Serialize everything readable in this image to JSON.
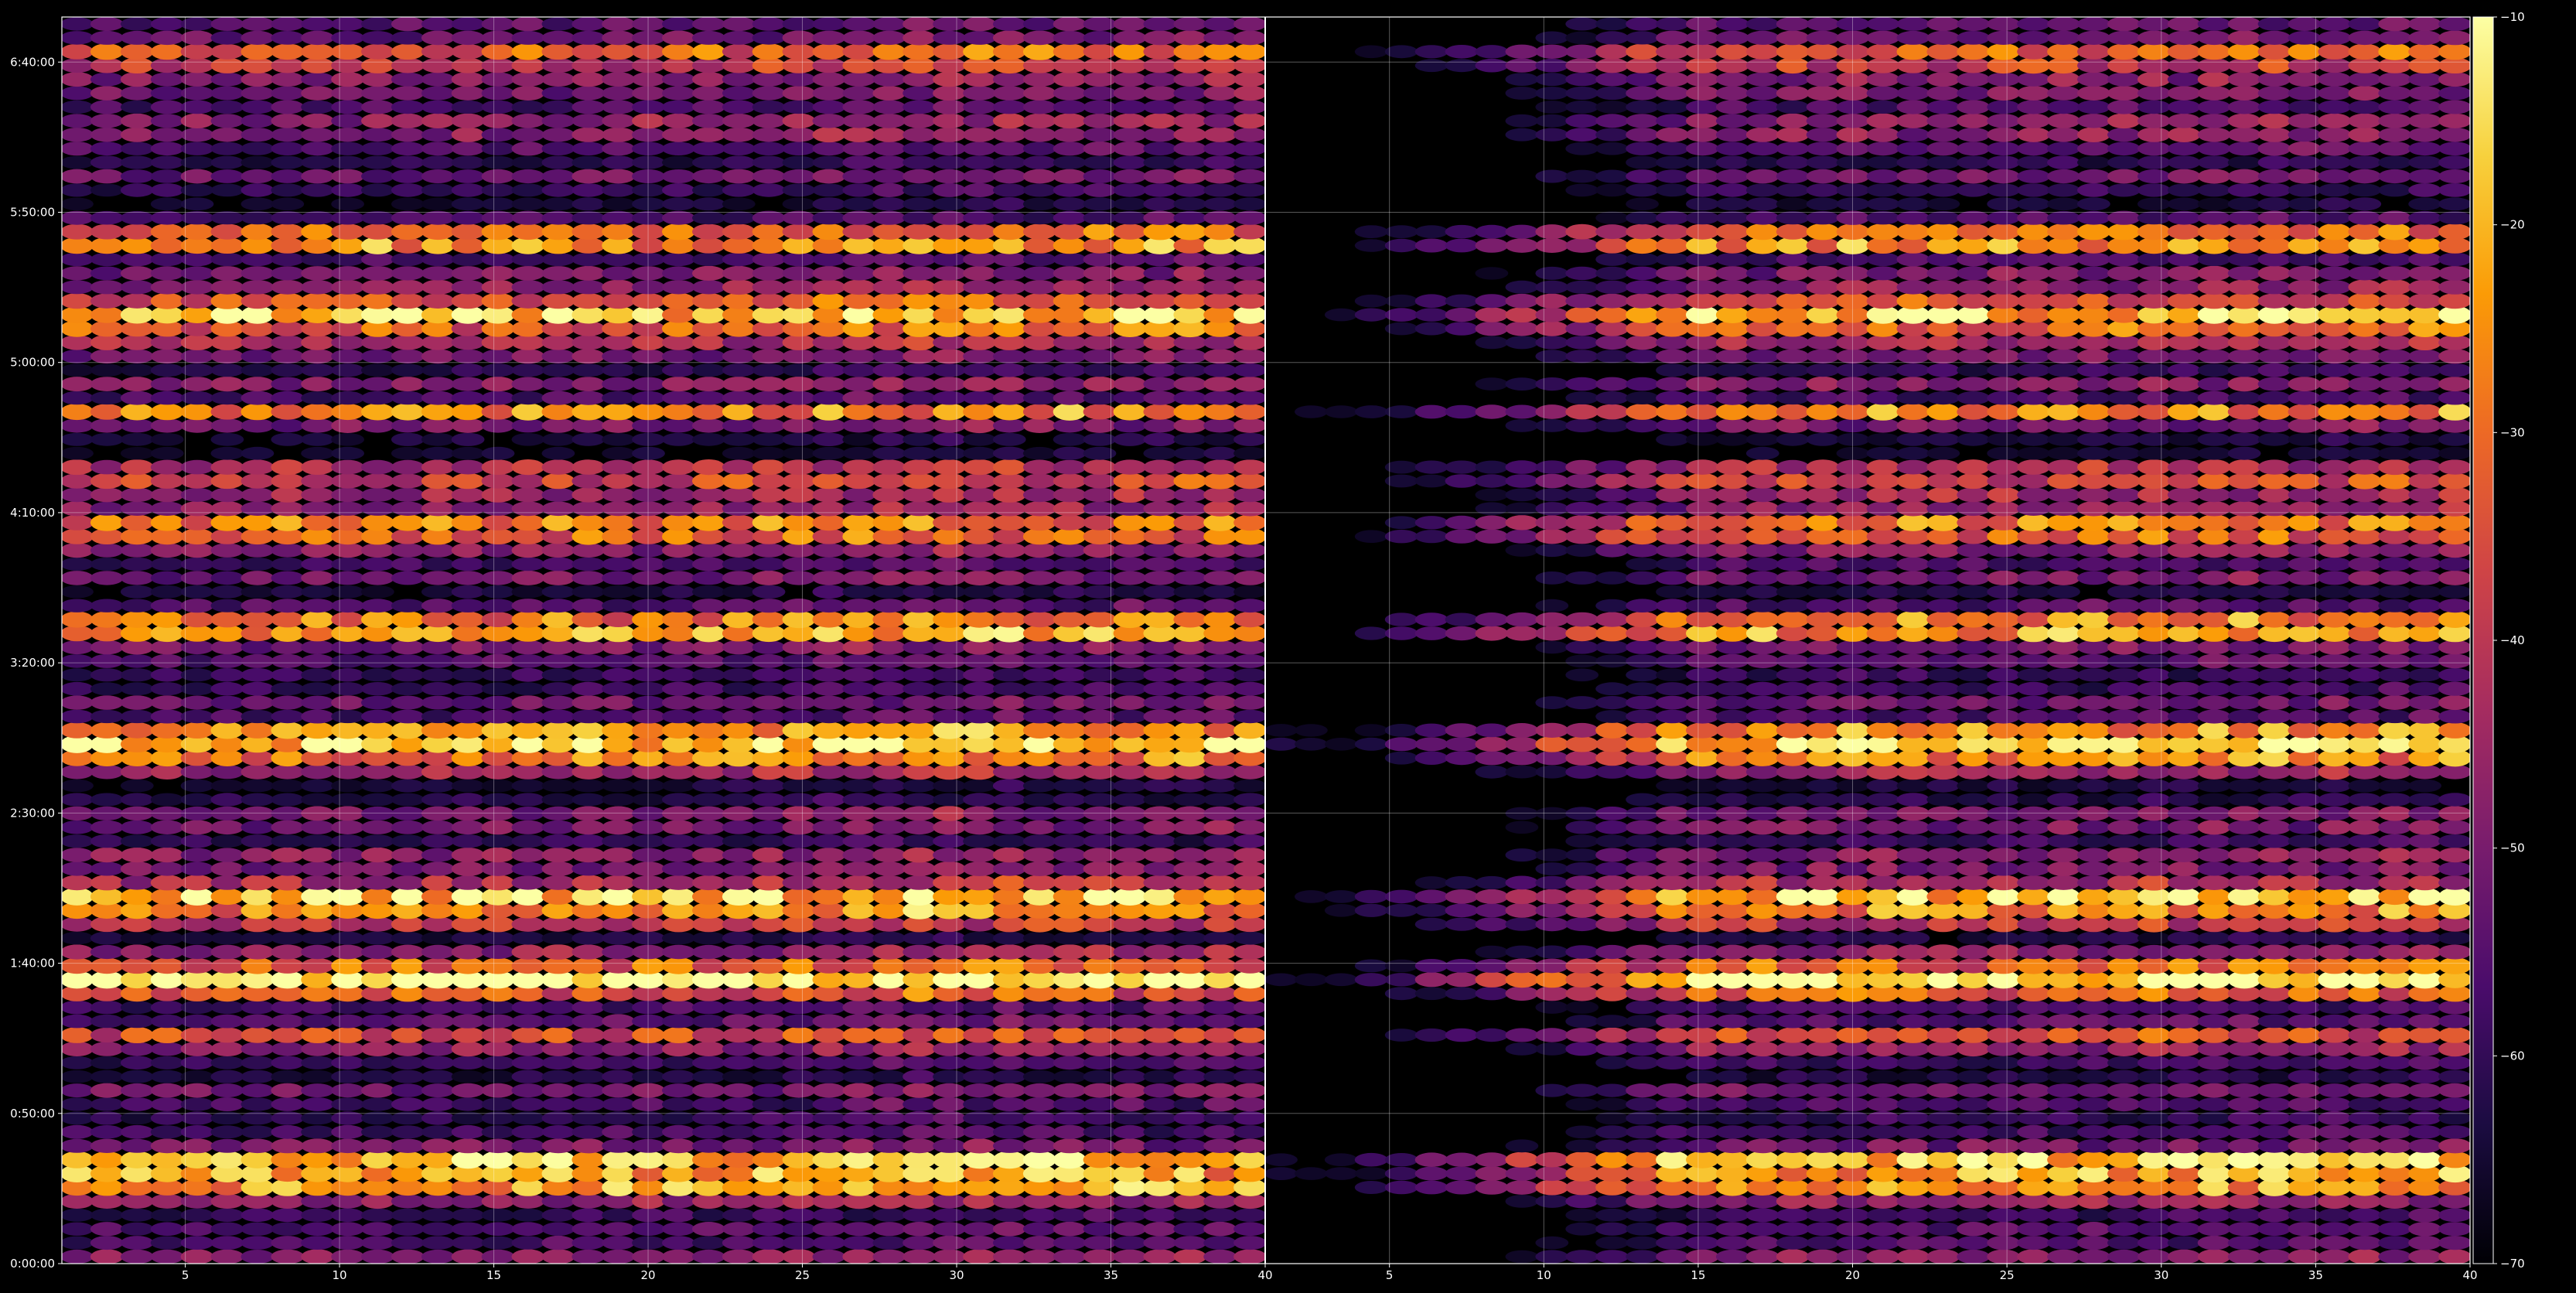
{
  "chart_data": {
    "type": "heatmap",
    "title": "",
    "xlabel": "",
    "ylabel": "",
    "background": "#000000",
    "grid": true,
    "colormap": "inferno",
    "colormap_stops": [
      "#000004",
      "#1b0c41",
      "#4a0c6b",
      "#781c6d",
      "#a52c60",
      "#cf4446",
      "#ed6925",
      "#fb9b06",
      "#f7d13d",
      "#fcffa4"
    ],
    "rows_per_panel": 90,
    "panels": [
      {
        "xlim": [
          1,
          40
        ],
        "x_ticks": [
          5,
          10,
          15,
          20,
          25,
          30,
          35,
          40
        ],
        "x_tick_labels": [
          "5",
          "10",
          "15",
          "20",
          "25",
          "30",
          "35",
          "40"
        ],
        "early_columns_suppressed": false
      },
      {
        "xlim": [
          1,
          40
        ],
        "x_ticks": [
          5,
          10,
          15,
          20,
          25,
          30,
          35,
          40
        ],
        "x_tick_labels": [
          "5",
          "10",
          "15",
          "20",
          "25",
          "30",
          "35",
          "40"
        ],
        "early_columns_suppressed": true
      }
    ],
    "y_ticks_seconds": [
      0,
      3000,
      6000,
      9000,
      12000,
      15000,
      18000,
      21000,
      24000
    ],
    "y_tick_labels": [
      "0:00:00",
      "0:50:00",
      "1:40:00",
      "2:30:00",
      "3:20:00",
      "4:10:00",
      "5:00:00",
      "5:50:00",
      "6:40:00"
    ],
    "ylim_seconds": [
      0,
      24900
    ],
    "strong_band_times_seconds": [
      1500,
      1800,
      2100,
      4600,
      5500,
      5800,
      7000,
      7300,
      10200,
      10500,
      12600,
      12900,
      14700,
      15600,
      17000,
      18800,
      19200,
      20400,
      24100
    ],
    "colorbar": {
      "range": [
        -70,
        -10
      ],
      "ticks": [
        -70,
        -60,
        -50,
        -40,
        -30,
        -20,
        -10
      ],
      "tick_labels": [
        "−70",
        "−60",
        "−50",
        "−40",
        "−30",
        "−20",
        "−10"
      ]
    }
  }
}
